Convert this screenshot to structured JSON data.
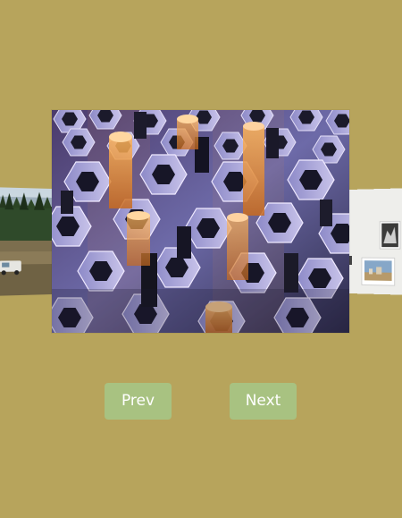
{
  "colors": {
    "background": "#b7a45c",
    "button_bg": "#a8c281",
    "button_text": "#ffffff"
  },
  "carousel": {
    "slides": [
      {
        "name": "forest-landscape",
        "position": "left"
      },
      {
        "name": "hexagon-3d-pattern",
        "position": "center"
      },
      {
        "name": "gallery-wall",
        "position": "right"
      }
    ]
  },
  "controls": {
    "prev_label": "Prev",
    "next_label": "Next"
  }
}
